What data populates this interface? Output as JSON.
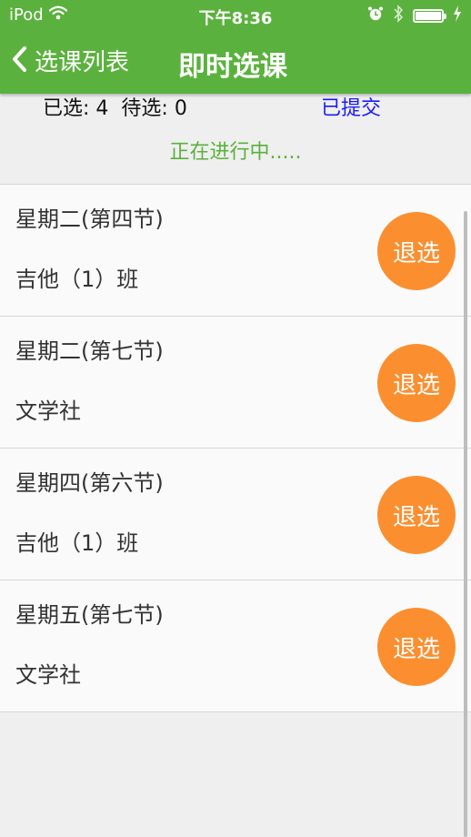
{
  "status_bar": {
    "carrier": "iPod",
    "time": "下午8:36",
    "icons": [
      "wifi-icon",
      "alarm-icon",
      "bluetooth-icon",
      "battery-icon",
      "charging-icon"
    ],
    "battery_level": 1.0
  },
  "nav": {
    "back_label": "选课列表",
    "title": "即时选课"
  },
  "summary": {
    "selected_label": "已选:",
    "selected_count": "4",
    "pending_label": "待选:",
    "pending_count": "0",
    "status": "已提交",
    "progress": "正在进行中....."
  },
  "courses": [
    {
      "time": "星期二(第四节)",
      "name": "吉他（1）班",
      "action": "退选"
    },
    {
      "time": "星期二(第七节)",
      "name": "文学社",
      "action": "退选"
    },
    {
      "time": "星期四(第六节)",
      "name": "吉他（1）班",
      "action": "退选"
    },
    {
      "time": "星期五(第七节)",
      "name": "文学社",
      "action": "退选"
    }
  ],
  "colors": {
    "header": "#5bb13d",
    "drop_button": "#fb8f2f",
    "submitted_text": "#1a1aff",
    "progress_text": "#5bb13d"
  }
}
